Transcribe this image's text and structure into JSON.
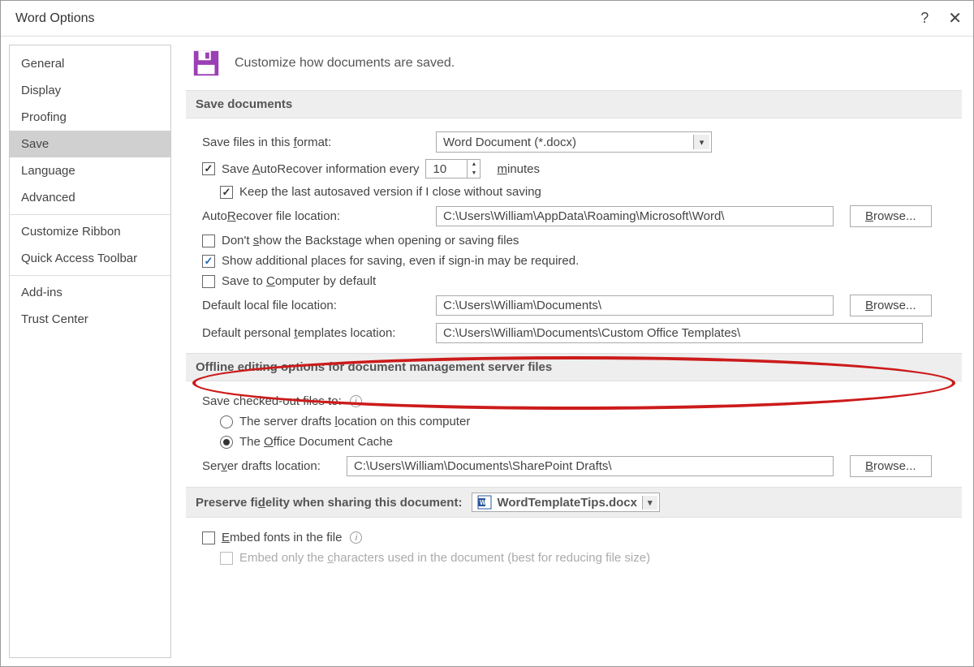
{
  "window": {
    "title": "Word Options",
    "help_icon": "?",
    "close_icon": "✕"
  },
  "sidebar": {
    "items": [
      {
        "label": "General"
      },
      {
        "label": "Display"
      },
      {
        "label": "Proofing"
      },
      {
        "label": "Save",
        "selected": true
      },
      {
        "label": "Language"
      },
      {
        "label": "Advanced"
      },
      {
        "label": "Customize Ribbon"
      },
      {
        "label": "Quick Access Toolbar"
      },
      {
        "label": "Add-ins"
      },
      {
        "label": "Trust Center"
      }
    ]
  },
  "header": {
    "title": "Customize how documents are saved."
  },
  "save_section": {
    "title": "Save documents",
    "format_label": "Save files in this format:",
    "format_value": "Word Document (*.docx)",
    "autorecover_label": "Save AutoRecover information every",
    "autorecover_value": "10",
    "autorecover_unit": "minutes",
    "keep_last_label": "Keep the last autosaved version if I close without saving",
    "autorecover_loc_label": "AutoRecover file location:",
    "autorecover_loc_value": "C:\\Users\\William\\AppData\\Roaming\\Microsoft\\Word\\",
    "dont_show_backstage_label": "Don't show the Backstage when opening or saving files",
    "show_additional_label": "Show additional places for saving, even if sign-in may be required.",
    "save_computer_label": "Save to Computer by default",
    "default_local_label": "Default local file location:",
    "default_local_value": "C:\\Users\\William\\Documents\\",
    "personal_templates_label": "Default personal templates location:",
    "personal_templates_value": "C:\\Users\\William\\Documents\\Custom Office Templates\\",
    "browse_label": "Browse..."
  },
  "offline_section": {
    "title": "Offline editing options for document management server files",
    "save_checked_out_label": "Save checked-out files to:",
    "radio_server_drafts": "The server drafts location on this computer",
    "radio_office_cache": "The Office Document Cache",
    "server_drafts_label": "Server drafts location:",
    "server_drafts_value": "C:\\Users\\William\\Documents\\SharePoint Drafts\\",
    "browse_label": "Browse..."
  },
  "preserve_section": {
    "title": "Preserve fidelity when sharing this document:",
    "doc_name": "WordTemplateTips.docx",
    "embed_fonts_label": "Embed fonts in the file",
    "embed_only_chars_label": "Embed only the characters used in the document (best for reducing file size)"
  },
  "underlines": {
    "f": "f",
    "A": "A",
    "m": "m",
    "R": "R",
    "B": "B",
    "s": "s",
    "C": "C",
    "t": "t",
    "l": "l",
    "O": "O",
    "e": "e",
    "E": "E",
    "c": "c",
    "d": "d"
  }
}
